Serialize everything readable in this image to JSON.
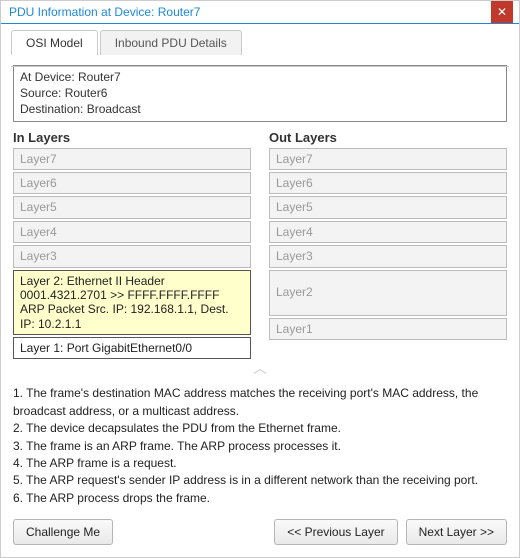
{
  "window": {
    "title": "PDU Information at Device: Router7"
  },
  "tabs": {
    "osi": "OSI Model",
    "inbound": "Inbound PDU Details"
  },
  "info": {
    "line1": "At Device: Router7",
    "line2": "Source: Router6",
    "line3": "Destination: Broadcast"
  },
  "headers": {
    "in": "In Layers",
    "out": "Out Layers"
  },
  "in_layers": {
    "l7": "Layer7",
    "l6": "Layer6",
    "l5": "Layer5",
    "l4": "Layer4",
    "l3": "Layer3",
    "l2": "Layer 2: Ethernet II Header 0001.4321.2701 >> FFFF.FFFF.FFFF ARP Packet Src. IP: 192.168.1.1, Dest. IP: 10.2.1.1",
    "l1": "Layer 1: Port GigabitEthernet0/0"
  },
  "out_layers": {
    "l7": "Layer7",
    "l6": "Layer6",
    "l5": "Layer5",
    "l4": "Layer4",
    "l3": "Layer3",
    "l2": "Layer2",
    "l1": "Layer1"
  },
  "description": {
    "d1": "1. The frame's destination MAC address matches the receiving port's MAC address, the broadcast address, or a multicast address.",
    "d2": "2. The device decapsulates the PDU from the Ethernet frame.",
    "d3": "3. The frame is an ARP frame. The ARP process processes it.",
    "d4": "4. The ARP frame is a request.",
    "d5": "5. The ARP request's sender IP address is in a different network than the receiving port.",
    "d6": "6. The ARP process drops the frame."
  },
  "buttons": {
    "challenge": "Challenge Me",
    "prev": "<< Previous Layer",
    "next": "Next Layer >>"
  }
}
